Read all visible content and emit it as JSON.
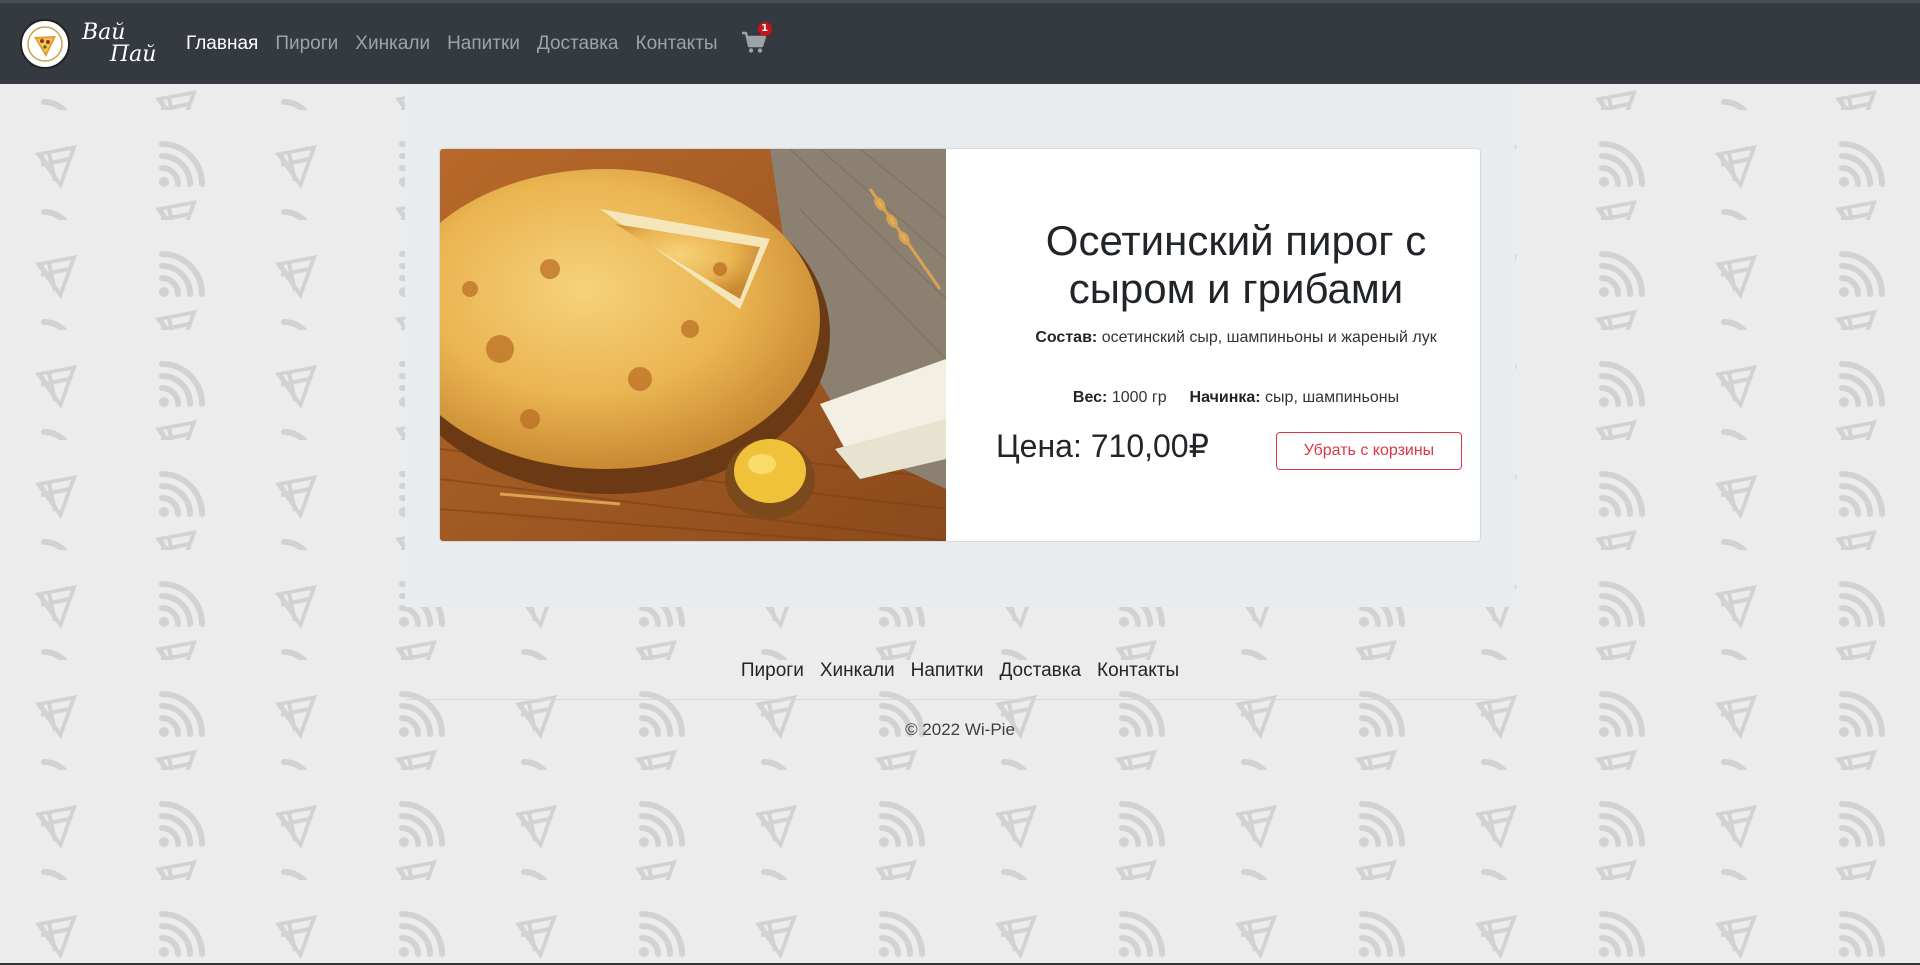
{
  "brand": {
    "line1": "Вай",
    "line2": "Пай"
  },
  "nav": {
    "items": [
      {
        "label": "Главная",
        "active": true
      },
      {
        "label": "Пироги",
        "active": false
      },
      {
        "label": "Хинкали",
        "active": false
      },
      {
        "label": "Напитки",
        "active": false
      },
      {
        "label": "Доставка",
        "active": false
      },
      {
        "label": "Контакты",
        "active": false
      }
    ],
    "cart_icon": "shopping-cart-icon",
    "cart_count": "1"
  },
  "product": {
    "title": "Осетинский пирог с сыром и грибами",
    "composition_label": "Состав:",
    "composition_value": "осетинский сыр, шампиньоны и жареный лук",
    "weight_label": "Вес:",
    "weight_value": "1000 гр",
    "filling_label": "Начинка:",
    "filling_value": "сыр, шампиньоны",
    "price": "Цена: 710,00₽",
    "remove_button": "Убрать с корзины"
  },
  "footer": {
    "links": [
      "Пироги",
      "Хинкали",
      "Напитки",
      "Доставка",
      "Контакты"
    ],
    "copyright": "© 2022 Wi-Pie"
  },
  "colors": {
    "navbar": "#343a40",
    "accent_danger": "#dc3545",
    "badge": "#c0161b",
    "page_bg": "#ececec",
    "panel_bg": "#e9ecef"
  }
}
